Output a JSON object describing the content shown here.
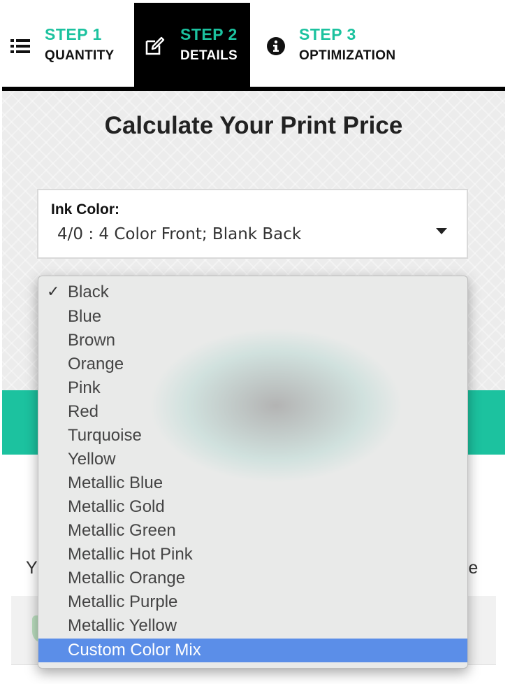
{
  "tabs": [
    {
      "step": "STEP 1",
      "name": "QUANTITY",
      "icon": "list-icon"
    },
    {
      "step": "STEP 2",
      "name": "DETAILS",
      "icon": "edit-icon"
    },
    {
      "step": "STEP 3",
      "name": "OPTIMIZATION",
      "icon": "info-icon"
    }
  ],
  "main": {
    "title": "Calculate Your Print Price",
    "ink_color": {
      "label": "Ink Color:",
      "value": "4/0 : 4 Color Front; Blank Back"
    },
    "below_left": "Y",
    "below_right": "re"
  },
  "dropdown": {
    "checked": "Black",
    "highlighted": "Custom Color Mix",
    "check_glyph": "✓",
    "options": [
      "Black",
      "Blue",
      "Brown",
      "Orange",
      "Pink",
      "Red",
      "Turquoise",
      "Yellow",
      "Metallic Blue",
      "Metallic Gold",
      "Metallic Green",
      "Metallic Hot Pink",
      "Metallic Orange",
      "Metallic Purple",
      "Metallic Yellow",
      "Custom Color Mix"
    ]
  },
  "colors": {
    "accent": "#1cc29f",
    "tab_active_bg": "#000000",
    "highlight": "#5b8ee8"
  }
}
